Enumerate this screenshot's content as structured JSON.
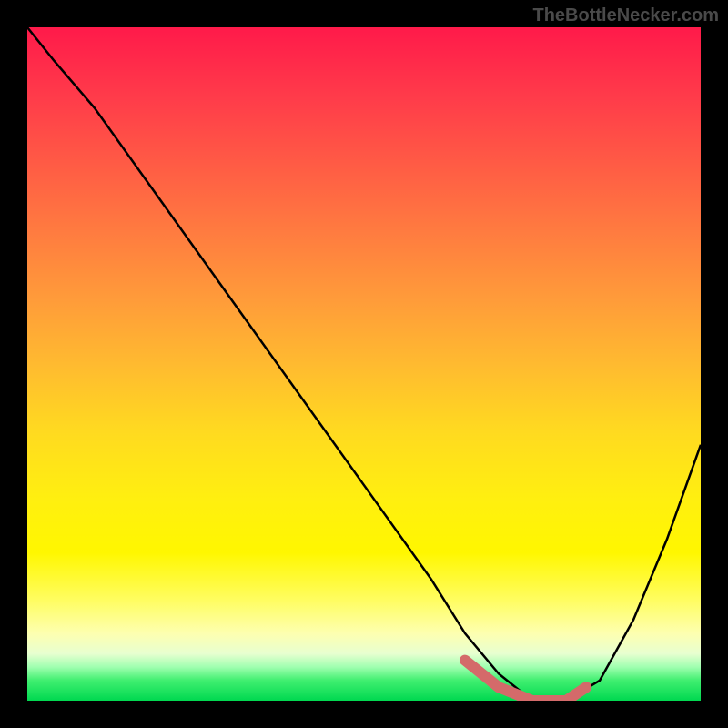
{
  "watermark": "TheBottleNecker.com",
  "chart_data": {
    "type": "line",
    "title": "",
    "xlabel": "",
    "ylabel": "",
    "xlim": [
      0,
      100
    ],
    "ylim": [
      0,
      100
    ],
    "x": [
      0,
      4,
      10,
      20,
      30,
      40,
      50,
      60,
      65,
      70,
      75,
      80,
      85,
      90,
      95,
      100
    ],
    "values": [
      100,
      95,
      88,
      74,
      60,
      46,
      32,
      18,
      10,
      4,
      0,
      0,
      3,
      12,
      24,
      38
    ],
    "highlight": {
      "x": [
        65,
        70,
        75,
        80,
        83
      ],
      "values": [
        6,
        2,
        0,
        0,
        2
      ]
    },
    "annotations": []
  },
  "colors": {
    "curve": "#000000",
    "highlight": "#d46a6a",
    "background_top": "#ff1a4a",
    "background_bottom": "#00d850"
  }
}
